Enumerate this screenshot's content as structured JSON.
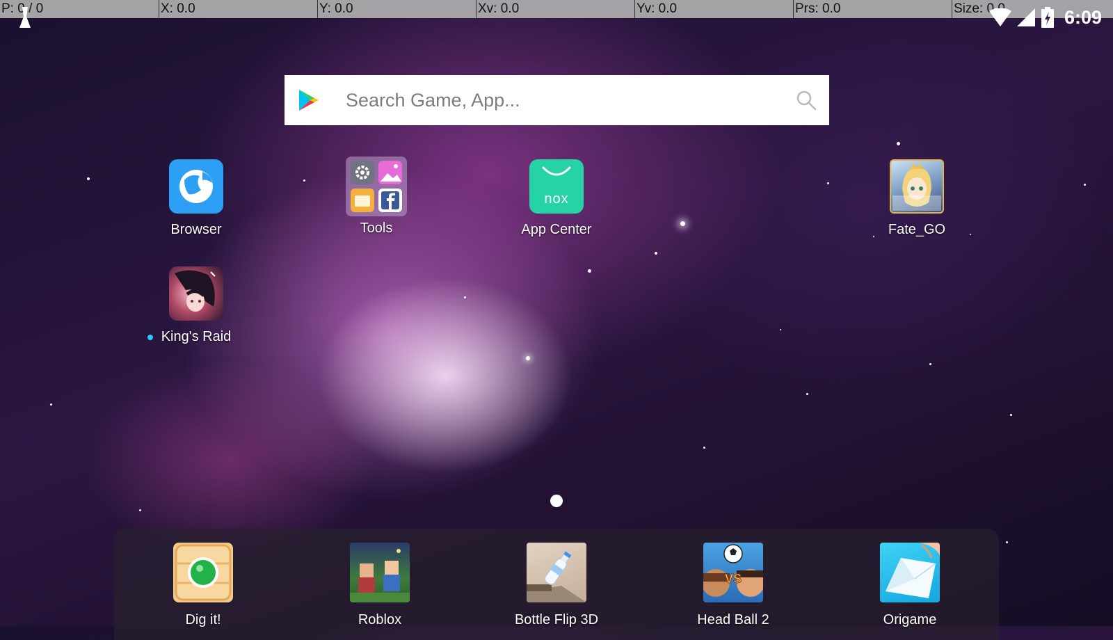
{
  "pointer_bar": {
    "p": "P: 0 / 0",
    "x": "X: 0.0",
    "y": "Y: 0.0",
    "xv": "Xv: 0.0",
    "yv": "Yv: 0.0",
    "prs": "Prs: 0.0",
    "size": "Size: 0.0"
  },
  "status_bar": {
    "time": "6:09",
    "icons": [
      "wifi-icon",
      "signal-icon",
      "battery-charging-icon"
    ]
  },
  "search": {
    "placeholder": "Search Game, App...",
    "icons": [
      "play-store-icon",
      "search-icon"
    ]
  },
  "desktop": {
    "apps": [
      {
        "label": "Browser",
        "icon": "browser-icon"
      },
      {
        "label": "Tools",
        "icon": "tools-folder-icon",
        "folder_items": [
          "settings-icon",
          "gallery-icon",
          "file-manager-icon",
          "facebook-icon"
        ]
      },
      {
        "label": "App Center",
        "icon": "nox-app-center-icon",
        "icon_text": "nox"
      },
      {
        "label": "Fate_GO",
        "icon": "fate-go-icon"
      },
      {
        "label": "King's Raid",
        "icon": "kings-raid-icon",
        "new_indicator": true
      }
    ]
  },
  "page_indicator": {
    "current": 1,
    "total": 1
  },
  "dock": {
    "apps": [
      {
        "label": "Dig it!",
        "icon": "dig-it-icon"
      },
      {
        "label": "Roblox",
        "icon": "roblox-icon"
      },
      {
        "label": "Bottle Flip 3D",
        "icon": "bottle-flip-icon"
      },
      {
        "label": "Head Ball 2",
        "icon": "head-ball-icon"
      },
      {
        "label": "Origame",
        "icon": "origame-icon"
      }
    ]
  },
  "colors": {
    "browser": "#2d9ff5",
    "nox": "#25d3a6",
    "nebula": "#7a3a86",
    "dot": "#33c4ff"
  }
}
